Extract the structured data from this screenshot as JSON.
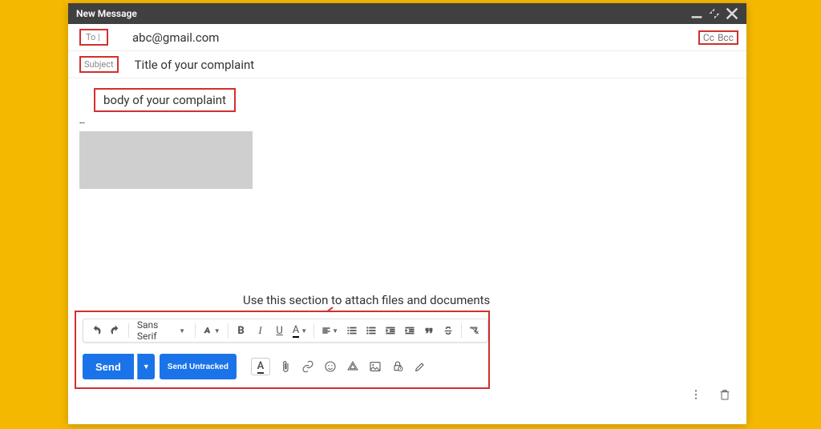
{
  "window": {
    "title": "New Message"
  },
  "fields": {
    "to_label": "To",
    "to_value": "abc@gmail.com",
    "cc_label": "Cc",
    "bcc_label": "Bcc",
    "subject_label": "Subject",
    "subject_value": "Title of your complaint"
  },
  "body": {
    "annotation": "body of your complaint",
    "sig_dash": "--"
  },
  "annotations": {
    "attach_hint": "Use this section to attach files and documents"
  },
  "format_bar": {
    "font_family": "Sans Serif"
  },
  "buttons": {
    "send": "Send",
    "send_untracked": "Send Untracked"
  }
}
